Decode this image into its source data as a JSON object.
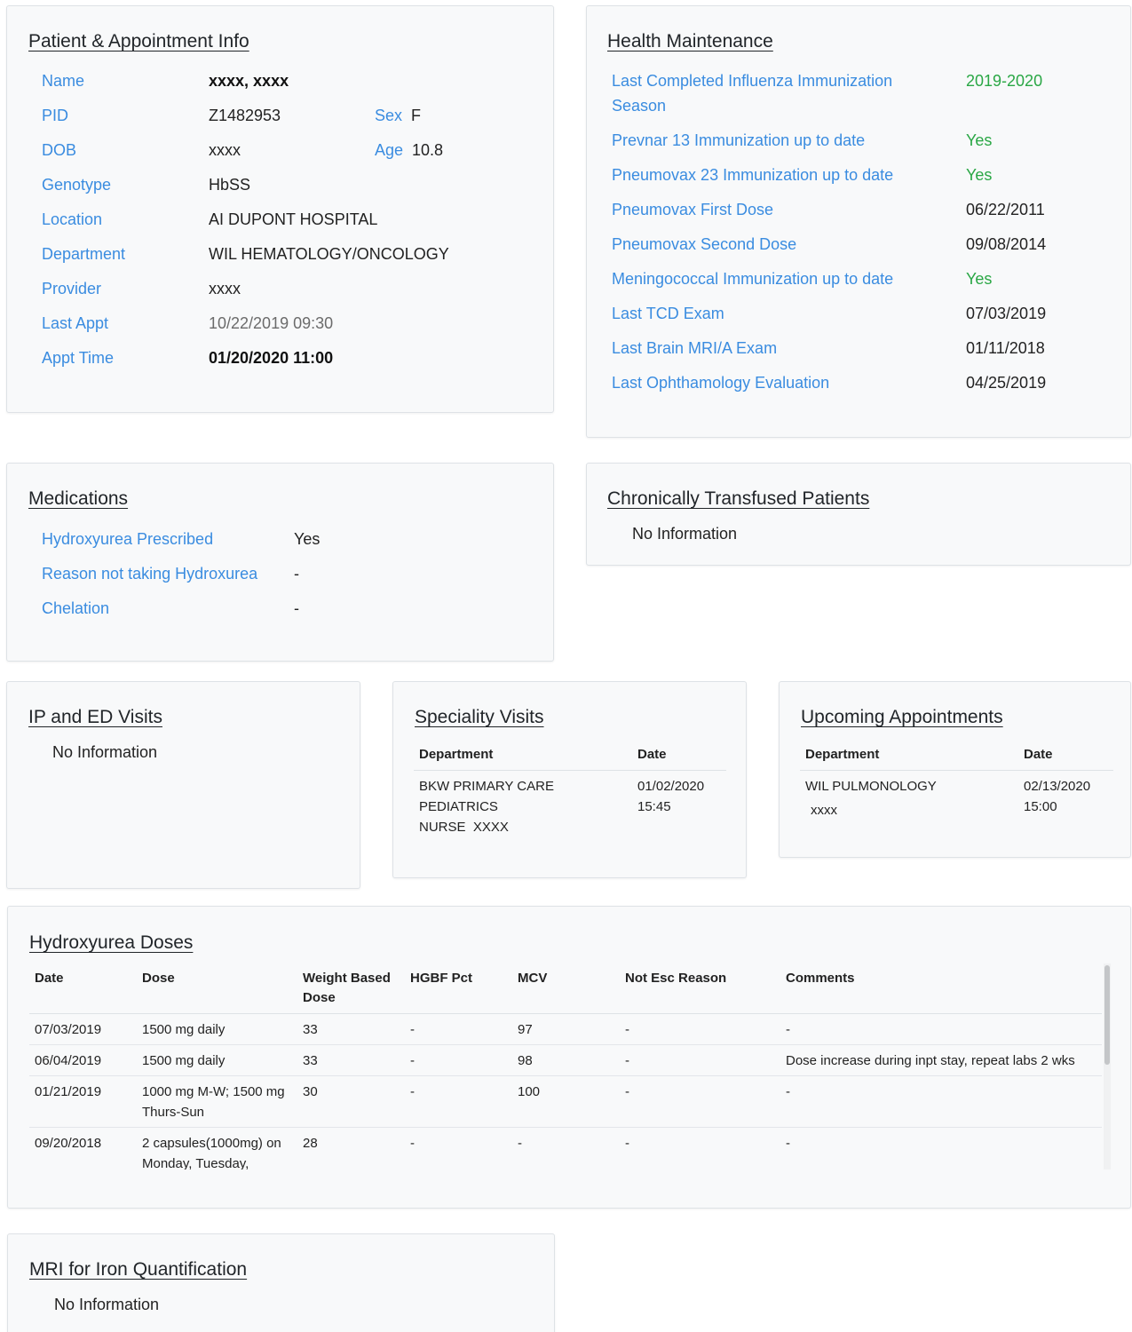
{
  "patient": {
    "title": "Patient & Appointment Info",
    "name_label": "Name",
    "name": "xxxx, xxxx",
    "pid_label": "PID",
    "pid": "Z1482953",
    "sex_label": "Sex",
    "sex": "F",
    "dob_label": "DOB",
    "dob": "xxxx",
    "age_label": "Age",
    "age": "10.8",
    "genotype_label": "Genotype",
    "genotype": "HbSS",
    "location_label": "Location",
    "location": "AI DUPONT HOSPITAL",
    "department_label": "Department",
    "department": "WIL HEMATOLOGY/ONCOLOGY",
    "provider_label": "Provider",
    "provider": "xxxx",
    "last_appt_label": "Last Appt",
    "last_appt": "10/22/2019 09:30",
    "appt_time_label": "Appt Time",
    "appt_time": "01/20/2020 11:00"
  },
  "health": {
    "title": "Health Maintenance",
    "items": [
      {
        "label_l1": "Last Completed Influenza Immunization",
        "label_l2": "Season",
        "value": "2019-2020"
      },
      {
        "label": "Prevnar 13 Immunization up to date",
        "value": "Yes"
      },
      {
        "label": "Pneumovax 23 Immunization up to date",
        "value": "Yes"
      },
      {
        "label": "Pneumovax First Dose",
        "value": "06/22/2011"
      },
      {
        "label": "Pneumovax Second Dose",
        "value": "09/08/2014"
      },
      {
        "label": "Meningococcal Immunization up to date",
        "value": "Yes"
      },
      {
        "label": "Last TCD Exam",
        "value": "07/03/2019"
      },
      {
        "label": "Last Brain MRI/A Exam",
        "value": "01/11/2018"
      },
      {
        "label": "Last Ophthamology Evaluation",
        "value": "04/25/2019"
      }
    ],
    "colors": {
      "positive": "#2aa745",
      "label": "#3a8ce0"
    }
  },
  "medications": {
    "title": "Medications",
    "items": [
      {
        "label": "Hydroxyurea Prescribed",
        "value": "Yes"
      },
      {
        "label": "Reason not taking Hydroxurea",
        "value": "-"
      },
      {
        "label": "Chelation",
        "value": "-"
      }
    ]
  },
  "transfused": {
    "title": "Chronically Transfused Patients",
    "text": "No Information"
  },
  "ip_ed": {
    "title": "IP and ED Visits",
    "text": "No Information"
  },
  "speciality": {
    "title": "Speciality Visits",
    "headers": [
      "Department",
      "Date"
    ],
    "rows": [
      {
        "dept_l1": "BKW PRIMARY CARE",
        "dept_l2": "PEDIATRICS",
        "dept_l3": "NURSE  XXXX",
        "date_l1": "01/02/2020",
        "date_l2": "15:45"
      }
    ]
  },
  "upcoming": {
    "title": "Upcoming Appointments",
    "headers": [
      "Department",
      "Date"
    ],
    "rows": [
      {
        "dept_l1": "WIL PULMONOLOGY",
        "dept_l2": "xxxx",
        "date_l1": "02/13/2020",
        "date_l2": "15:00"
      }
    ]
  },
  "doses": {
    "title": "Hydroxyurea Doses",
    "headers": [
      "Date",
      "Dose",
      "Weight Based Dose",
      "HGBF Pct",
      "MCV",
      "Not Esc Reason",
      "Comments"
    ],
    "rows": [
      [
        "07/03/2019",
        "1500 mg daily",
        "33",
        "-",
        "97",
        "-",
        "-"
      ],
      [
        "06/04/2019",
        "1500 mg daily",
        "33",
        "-",
        "98",
        "-",
        "Dose increase during inpt stay, repeat labs 2 wks"
      ],
      [
        "01/21/2019",
        "1000 mg M-W; 1500 mg Thurs-Sun",
        "30",
        "-",
        "100",
        "-",
        "-"
      ],
      [
        "09/20/2018",
        "2 capsules(1000mg) on Monday, Tuesday,",
        "28",
        "-",
        "-",
        "-",
        "-"
      ]
    ]
  },
  "mri": {
    "title": "MRI for Iron Quantification",
    "text": "No Information"
  }
}
